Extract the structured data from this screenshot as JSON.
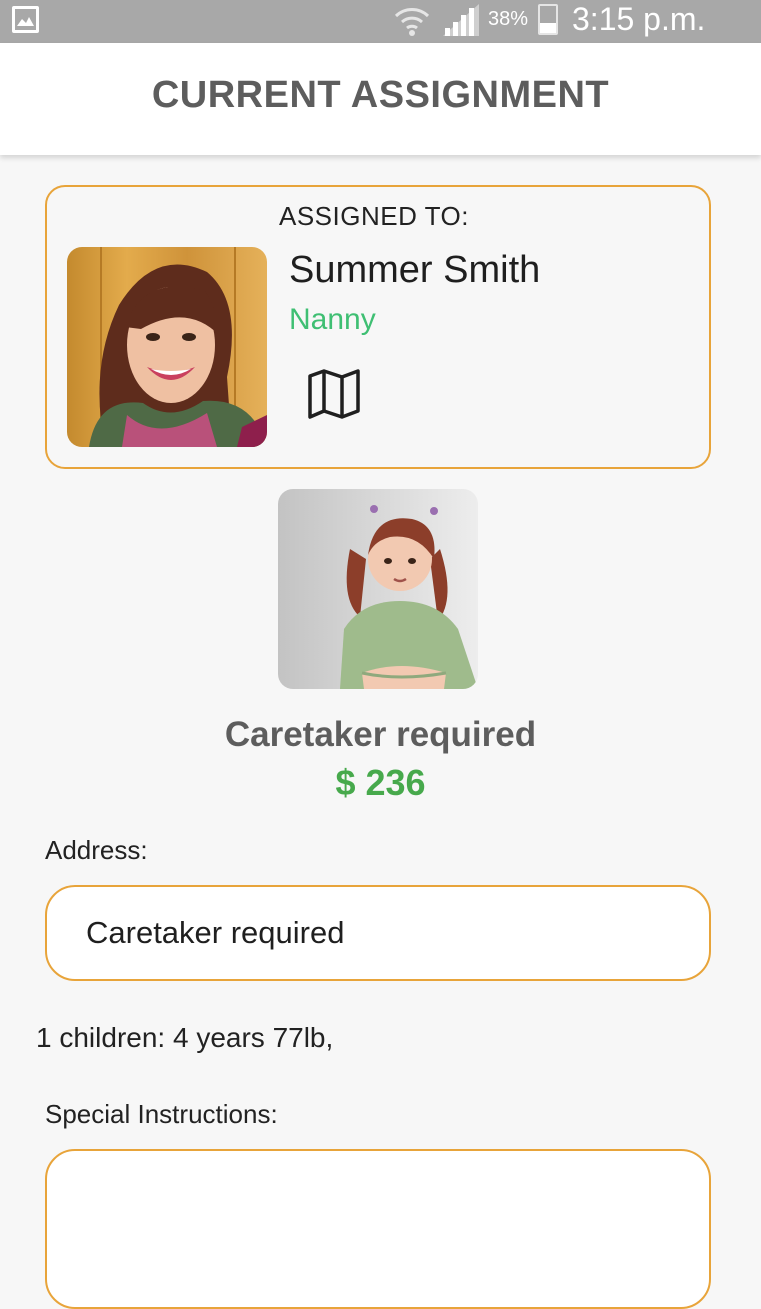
{
  "status_bar": {
    "battery": "38%",
    "time": "3:15 p.m.",
    "icons": [
      "gallery-icon",
      "wifi-icon",
      "signal-icon",
      "battery-icon"
    ]
  },
  "header": {
    "title": "CURRENT ASSIGNMENT"
  },
  "assignment": {
    "label": "ASSIGNED TO:",
    "name": "Summer Smith",
    "role": "Nanny",
    "map_icon": "map-icon"
  },
  "job": {
    "title": "Caretaker required",
    "price": "$ 236",
    "address_label": "Address:",
    "address": "Caretaker required",
    "children": "1 children: 4 years 77lb,",
    "instructions_label": "Special Instructions:",
    "instructions": ""
  },
  "colors": {
    "accent_border": "#e8a43a",
    "role_green": "#3fbf73",
    "price_green": "#47a94c",
    "title_gray": "#5d5d5d",
    "status_bar": "#a8a8a8"
  }
}
